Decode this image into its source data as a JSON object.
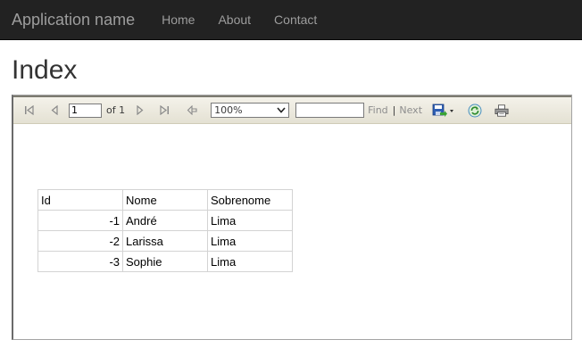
{
  "navbar": {
    "brand": "Application name",
    "links": [
      "Home",
      "About",
      "Contact"
    ]
  },
  "page": {
    "title": "Index"
  },
  "toolbar": {
    "page_number": "1",
    "of_label": "of 1",
    "zoom": "100%",
    "find_label": "Find",
    "separator": "|",
    "next_label": "Next"
  },
  "report": {
    "headers": [
      "Id",
      "Nome",
      "Sobrenome"
    ],
    "rows": [
      [
        "-1",
        "André",
        "Lima"
      ],
      [
        "-2",
        "Larissa",
        "Lima"
      ],
      [
        "-3",
        "Sophie",
        "Lima"
      ]
    ]
  }
}
